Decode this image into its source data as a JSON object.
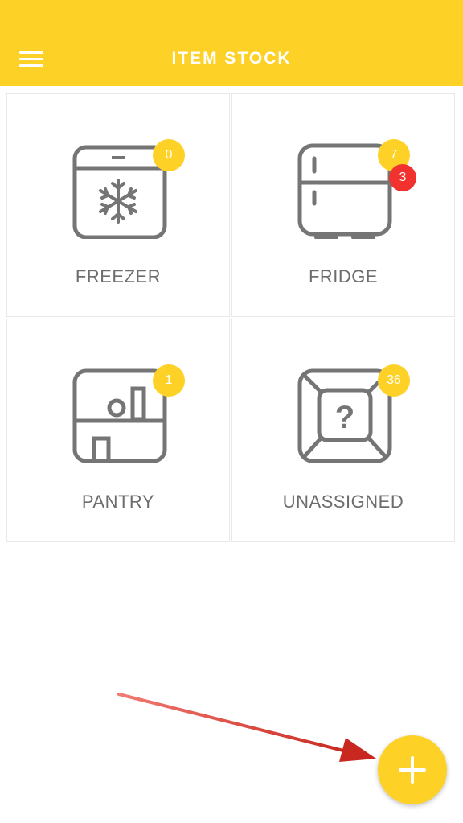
{
  "header": {
    "title": "ITEM STOCK",
    "menu_icon": "hamburger-menu-icon",
    "background_color": "#FDD126"
  },
  "tiles": [
    {
      "label": "FREEZER",
      "icon": "freezer-icon",
      "count": "0"
    },
    {
      "label": "FRIDGE",
      "icon": "fridge-icon",
      "count": "7",
      "alert_count": "3"
    },
    {
      "label": "PANTRY",
      "icon": "pantry-icon",
      "count": "1"
    },
    {
      "label": "UNASSIGNED",
      "icon": "unassigned-box-icon",
      "count": "36"
    }
  ],
  "fab": {
    "icon": "plus-icon",
    "color": "#FDD126"
  },
  "colors": {
    "accent": "#FDD126",
    "alert": "#F1322E",
    "icon_gray": "#757575",
    "annotation_arrow": "#D63A2F"
  }
}
